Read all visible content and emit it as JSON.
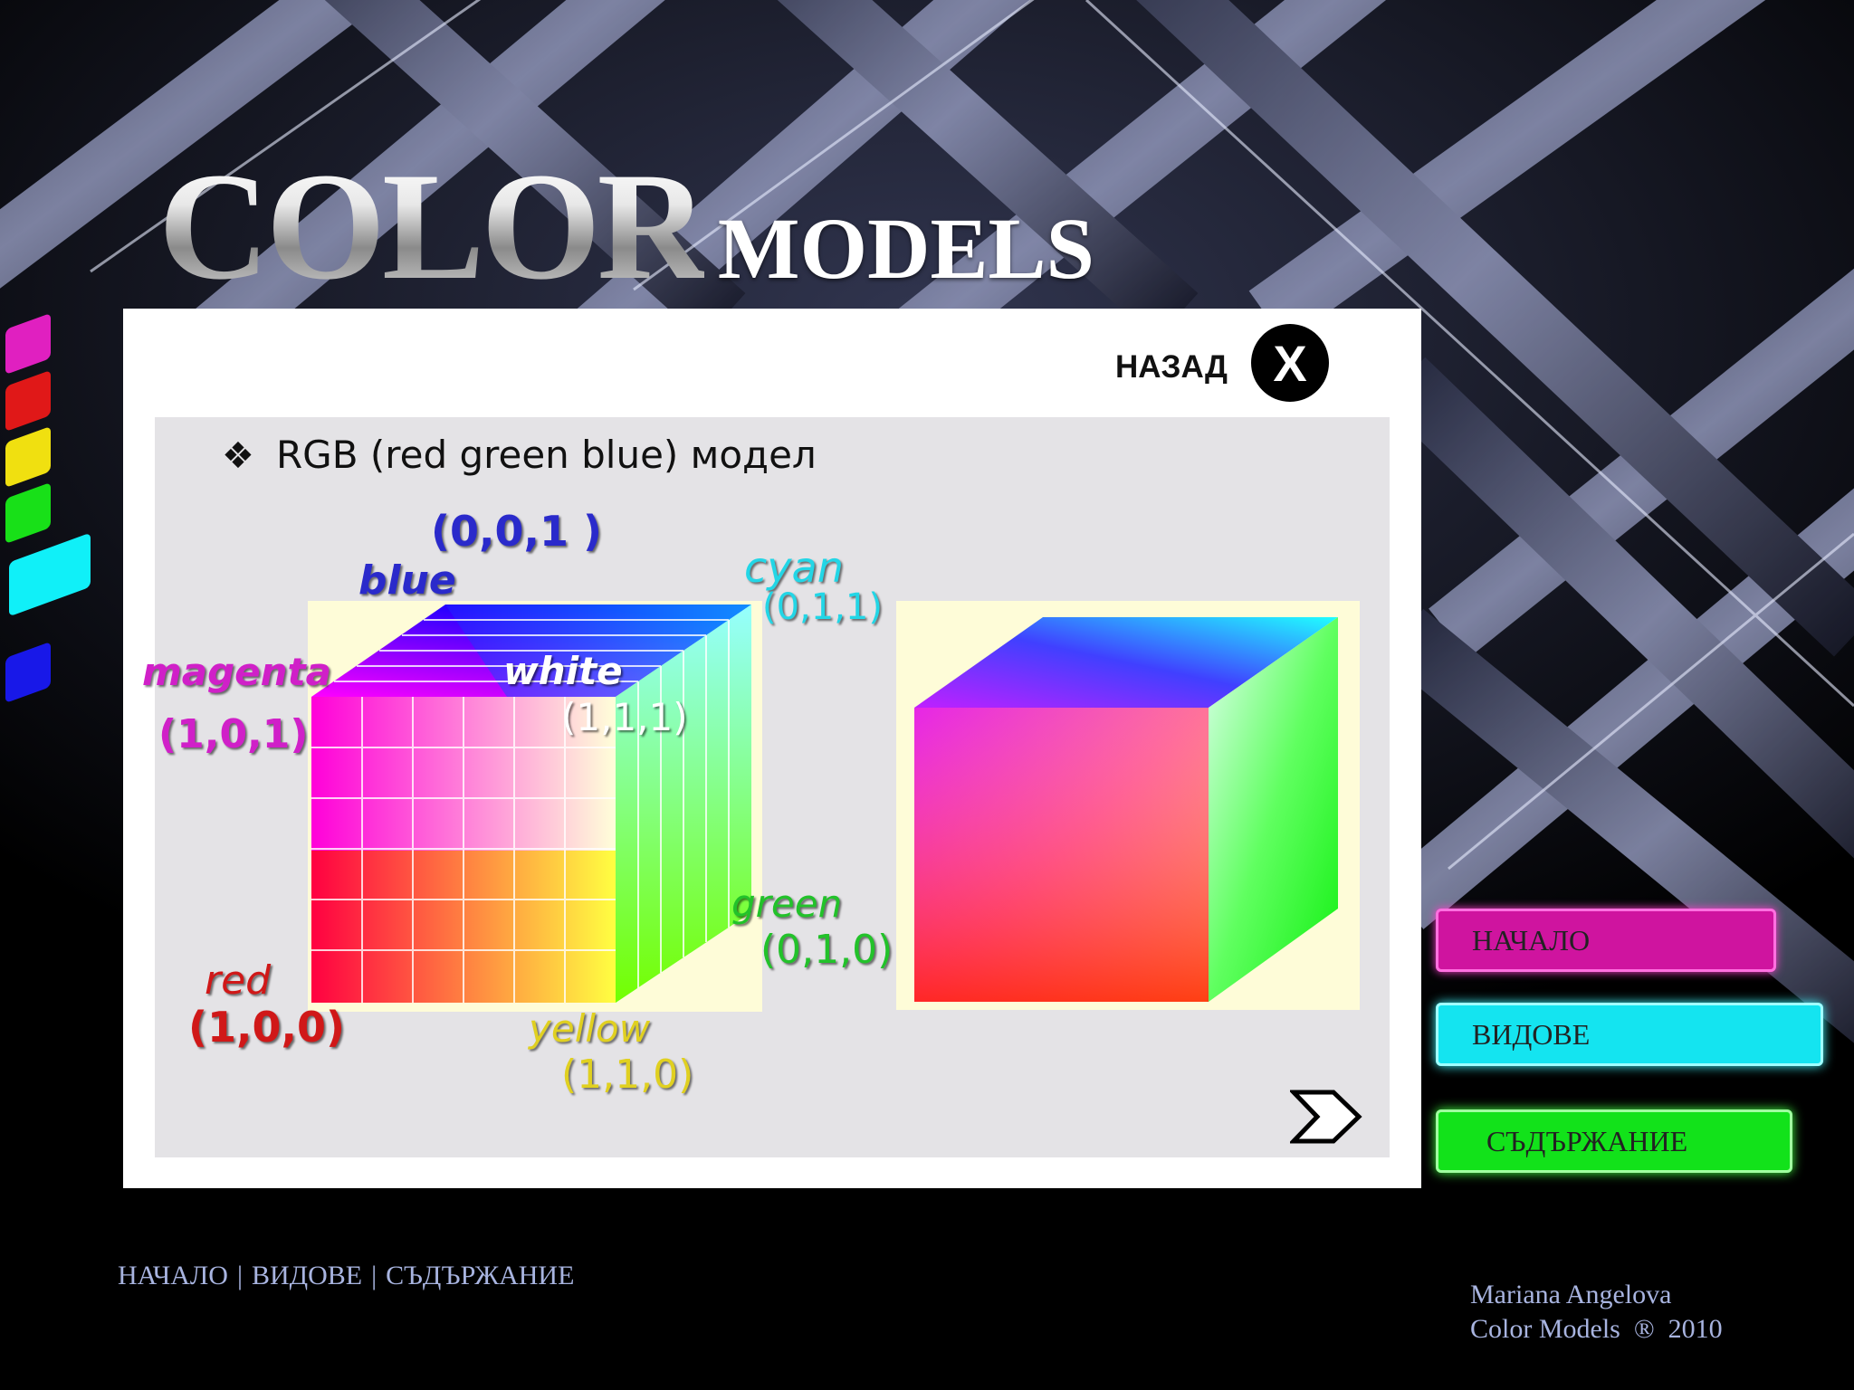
{
  "header": {
    "title_big": "COLOR",
    "title_small": "MODELS"
  },
  "panel": {
    "back_label": "НАЗАД",
    "close_glyph": "X",
    "close_icon": "close-icon",
    "bullet_icon": "❖",
    "bullet_text": "RGB (red green blue) модел"
  },
  "cube_labels": {
    "blue_coord": "(0,0,1 )",
    "blue": "blue",
    "cyan": "cyan",
    "cyan_coord": "(0,1,1)",
    "magenta": "magenta",
    "magenta_coord": "(1,0,1)",
    "white": "white",
    "white_coord": "(1,1,1)",
    "green": "green",
    "green_coord": "(0,1,0)",
    "red": "red",
    "red_coord": "(1,0,0)",
    "yellow": "yellow",
    "yellow_coord": "(1,1,0)"
  },
  "colors": {
    "blue_label": "#2020c8",
    "cyan_label": "#22d6e6",
    "magenta_label": "#d020c8",
    "white_label": "#ffffff",
    "green_label": "#22c22a",
    "red_label": "#d01818",
    "yellow_label": "#e0d020",
    "nav_start": "#d01aa8",
    "nav_types": "#19e6f0",
    "nav_contents": "#16e81a"
  },
  "nav": {
    "start": "НАЧАЛО",
    "types": "ВИДОВЕ",
    "contents": "СЪДЪРЖАНИЕ"
  },
  "footer": {
    "link_start": "НАЧАЛО",
    "sep1": "|",
    "link_types": "ВИДОВЕ",
    "sep2": "|",
    "link_contents": "СЪДЪРЖАНИЕ",
    "author": "Mariana Angelova",
    "copyright": "Color Models  ®  2010"
  },
  "next_icon": "chevron-right-icon"
}
